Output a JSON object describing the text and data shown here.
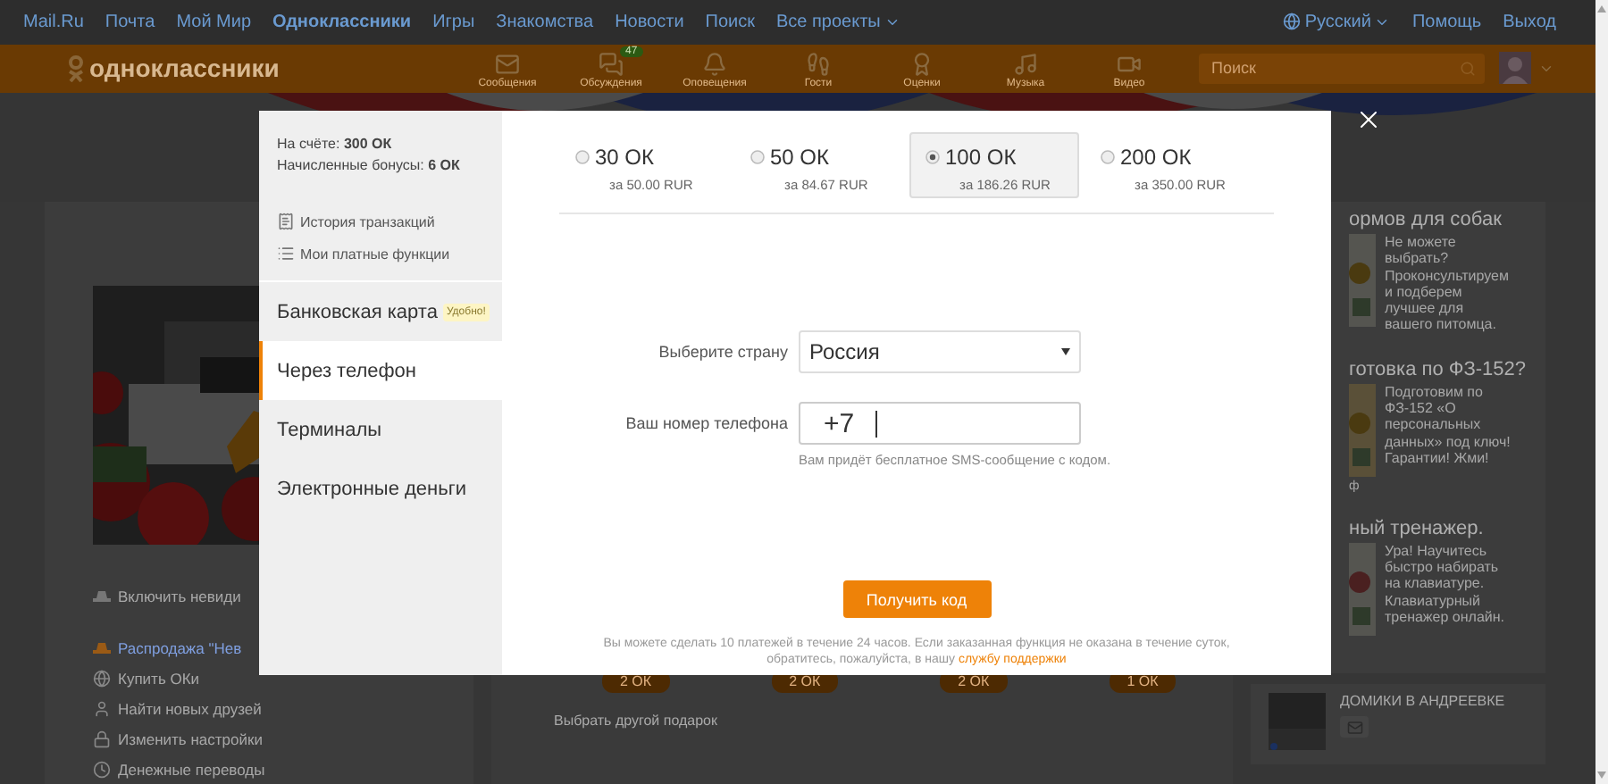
{
  "top_bar": {
    "links": [
      {
        "label": "Mail.Ru",
        "current": false,
        "menu": false
      },
      {
        "label": "Почта",
        "current": false,
        "menu": false
      },
      {
        "label": "Мой Мир",
        "current": false,
        "menu": false
      },
      {
        "label": "Одноклассники",
        "current": true,
        "menu": false
      },
      {
        "label": "Игры",
        "current": false,
        "menu": false
      },
      {
        "label": "Знакомства",
        "current": false,
        "menu": false
      },
      {
        "label": "Новости",
        "current": false,
        "menu": false
      },
      {
        "label": "Поиск",
        "current": false,
        "menu": false
      },
      {
        "label": "Все проекты",
        "current": false,
        "menu": true
      }
    ],
    "language": "Русский",
    "right_links": [
      "Помощь",
      "Выход"
    ]
  },
  "header": {
    "logo": "одноклассники",
    "nav": [
      {
        "label": "Сообщения",
        "kind": "mail"
      },
      {
        "label": "Обсуждения",
        "kind": "chat",
        "badge": "47"
      },
      {
        "label": "Оповещения",
        "kind": "bell"
      },
      {
        "label": "Гости",
        "kind": "steps"
      },
      {
        "label": "Оценки",
        "kind": "rating"
      },
      {
        "label": "Музыка",
        "kind": "music"
      },
      {
        "label": "Видео",
        "kind": "video"
      }
    ],
    "search": {
      "placeholder": "Поиск"
    }
  },
  "left_menu": [
    {
      "label": "Включить невиди",
      "kind": "plain"
    },
    {
      "label": "Распродажа \"Нев",
      "kind": "promo"
    },
    {
      "label": "Купить ОКи",
      "kind": "plain"
    },
    {
      "label": "Найти новых друзей",
      "kind": "plain"
    },
    {
      "label": "Изменить настройки",
      "kind": "plain"
    },
    {
      "label": "Денежные переводы",
      "kind": "plain"
    }
  ],
  "gifts": {
    "prices": [
      "2 ОК",
      "2 ОК",
      "2 ОК",
      "1 ОК"
    ],
    "other": "Выбрать другой подарок"
  },
  "ads": [
    {
      "title": "ормов для собак",
      "text": "Не можете выбрать? Проконсультируем и подберем лучшее для вашего питомца."
    },
    {
      "title": "готовка по ФЗ-152?",
      "text": "Подготовим по ФЗ-152 «О персональных данных» под ключ! Гарантии! Жми!",
      "source": "ф"
    },
    {
      "title": "ный тренажер.",
      "text": "Ура! Научитесь быстро набирать на клавиатуре. Клавиатурный тренажер онлайн."
    }
  ],
  "group_card": {
    "title": "ДОМИКИ В АНДРЕЕВКЕ"
  },
  "modal": {
    "balance": "На счёте: **300 ОК**",
    "bonus": "Начисленные бонусы: **6 ОК**",
    "links": [
      {
        "label": "История транзакций",
        "kind": "history"
      },
      {
        "label": "Мои платные функции",
        "kind": "list"
      }
    ],
    "methods": [
      {
        "label": "Банковская карта",
        "badge": "Удобно!",
        "selected": false
      },
      {
        "label": "Через телефон",
        "selected": true
      },
      {
        "label": "Терминалы",
        "selected": false
      },
      {
        "label": "Электронные деньги",
        "selected": false
      }
    ],
    "packages": [
      {
        "amount": "30 ОК",
        "price": "за 50.00 RUR",
        "selected": false
      },
      {
        "amount": "50 ОК",
        "price": "за 84.67 RUR",
        "selected": false
      },
      {
        "amount": "100 ОК",
        "price": "за 186.26 RUR",
        "selected": true
      },
      {
        "amount": "200 ОК",
        "price": "за 350.00 RUR",
        "selected": false
      }
    ],
    "form": {
      "country_label": "Выберите страну",
      "country": "Россия",
      "phone_label": "Ваш номер телефона",
      "phone_prefix": "+7",
      "hint": "Вам придёт бесплатное SMS-сообщение с кодом."
    },
    "submit": "Получить код",
    "note": "Вы можете сделать 10 платежей в течение 24 часов. Если заказанная функция не оказана в течение суток, обратитесь, пожалуйста, в нашу",
    "note_link": "службу поддержки"
  }
}
